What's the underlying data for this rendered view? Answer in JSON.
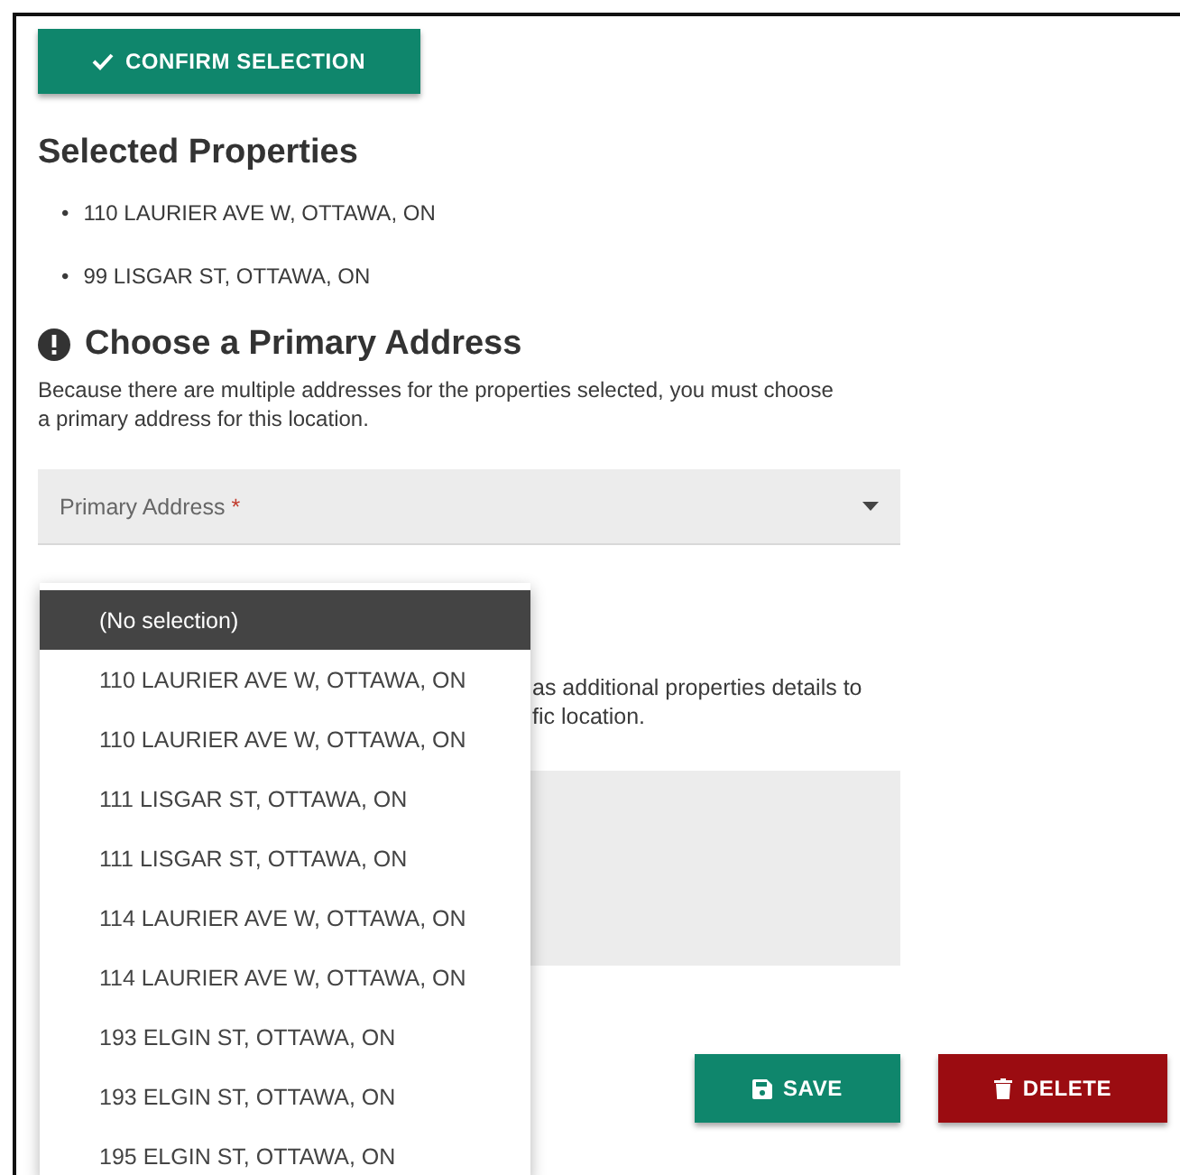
{
  "confirm_button": {
    "label": "CONFIRM SELECTION"
  },
  "selected_properties": {
    "title": "Selected Properties",
    "items": [
      {
        "bullet": "•",
        "text": "110 LAURIER AVE W, OTTAWA, ON"
      },
      {
        "bullet": "•",
        "text": "99 LISGAR ST, OTTAWA, ON"
      }
    ]
  },
  "primary_address": {
    "title": "Choose a Primary Address",
    "description": "Because there are multiple addresses for the properties selected, you must choose a primary address for this location.",
    "field": {
      "label": "Primary Address",
      "required_mark": "*"
    },
    "dropdown_options": [
      {
        "label": "(No selection)",
        "selected": true
      },
      {
        "label": "110 LAURIER AVE W, OTTAWA, ON",
        "selected": false
      },
      {
        "label": "110 LAURIER AVE W, OTTAWA, ON",
        "selected": false
      },
      {
        "label": "111 LISGAR ST, OTTAWA, ON",
        "selected": false
      },
      {
        "label": "111 LISGAR ST, OTTAWA, ON",
        "selected": false
      },
      {
        "label": "114 LAURIER AVE W, OTTAWA, ON",
        "selected": false
      },
      {
        "label": "114 LAURIER AVE W, OTTAWA, ON",
        "selected": false
      },
      {
        "label": "193 ELGIN ST, OTTAWA, ON",
        "selected": false
      },
      {
        "label": "193 ELGIN ST, OTTAWA, ON",
        "selected": false
      },
      {
        "label": "195 ELGIN ST, OTTAWA, ON",
        "selected": false
      }
    ]
  },
  "details": {
    "description_lines": [
      "as additional properties details to",
      "fic location."
    ]
  },
  "buttons": [
    {
      "kind": "save",
      "label": "SAVE"
    },
    {
      "kind": "delete",
      "label": "DELETE"
    }
  ]
}
